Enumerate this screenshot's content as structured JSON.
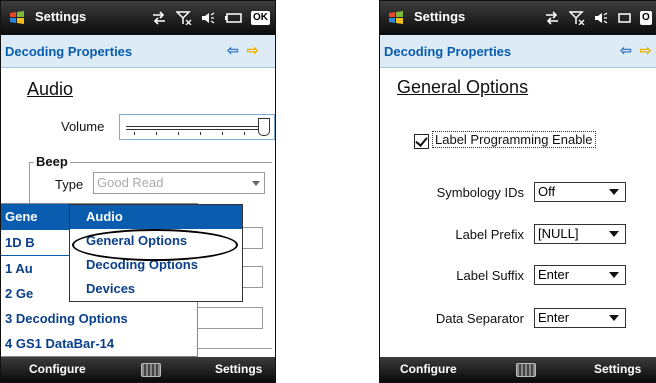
{
  "left": {
    "titlebar": {
      "title": "Settings",
      "ok": "OK"
    },
    "header": {
      "title": "Decoding Properties"
    },
    "section_title": "Audio",
    "volume_label": "Volume",
    "beep_group": {
      "legend": "Beep",
      "type_label": "Type",
      "type_value": "Good Read"
    },
    "menu_items": [
      {
        "label": "Gene",
        "selected": true
      },
      {
        "label": "1D B"
      },
      {
        "label": "1 Au"
      },
      {
        "label": "2 Ge"
      },
      {
        "label": "3 Decoding Options"
      },
      {
        "label": "4 GS1 DataBar-14"
      }
    ],
    "submenu_items": [
      {
        "label": "Audio",
        "selected": true
      },
      {
        "label": "General Options"
      },
      {
        "label": "Decoding Options"
      },
      {
        "label": "Devices"
      }
    ],
    "bottombar": {
      "left": "Configure",
      "right": "Settings"
    }
  },
  "right": {
    "titlebar": {
      "title": "Settings",
      "ok": "O"
    },
    "header": {
      "title": "Decoding Properties"
    },
    "section_title": "General Options",
    "checkbox": {
      "label": "Label Programming Enable",
      "checked": true
    },
    "rows": [
      {
        "label": "Symbology IDs",
        "value": "Off"
      },
      {
        "label": "Label Prefix",
        "value": "[NULL]"
      },
      {
        "label": "Label Suffix",
        "value": "Enter"
      },
      {
        "label": "Data Separator",
        "value": "Enter"
      }
    ],
    "bottombar": {
      "left": "Configure",
      "right": "Settings"
    }
  },
  "colors": {
    "accent": "#0a5cae",
    "header_bg": "#dcebf6",
    "bar_dark": "#0b0b0b"
  }
}
